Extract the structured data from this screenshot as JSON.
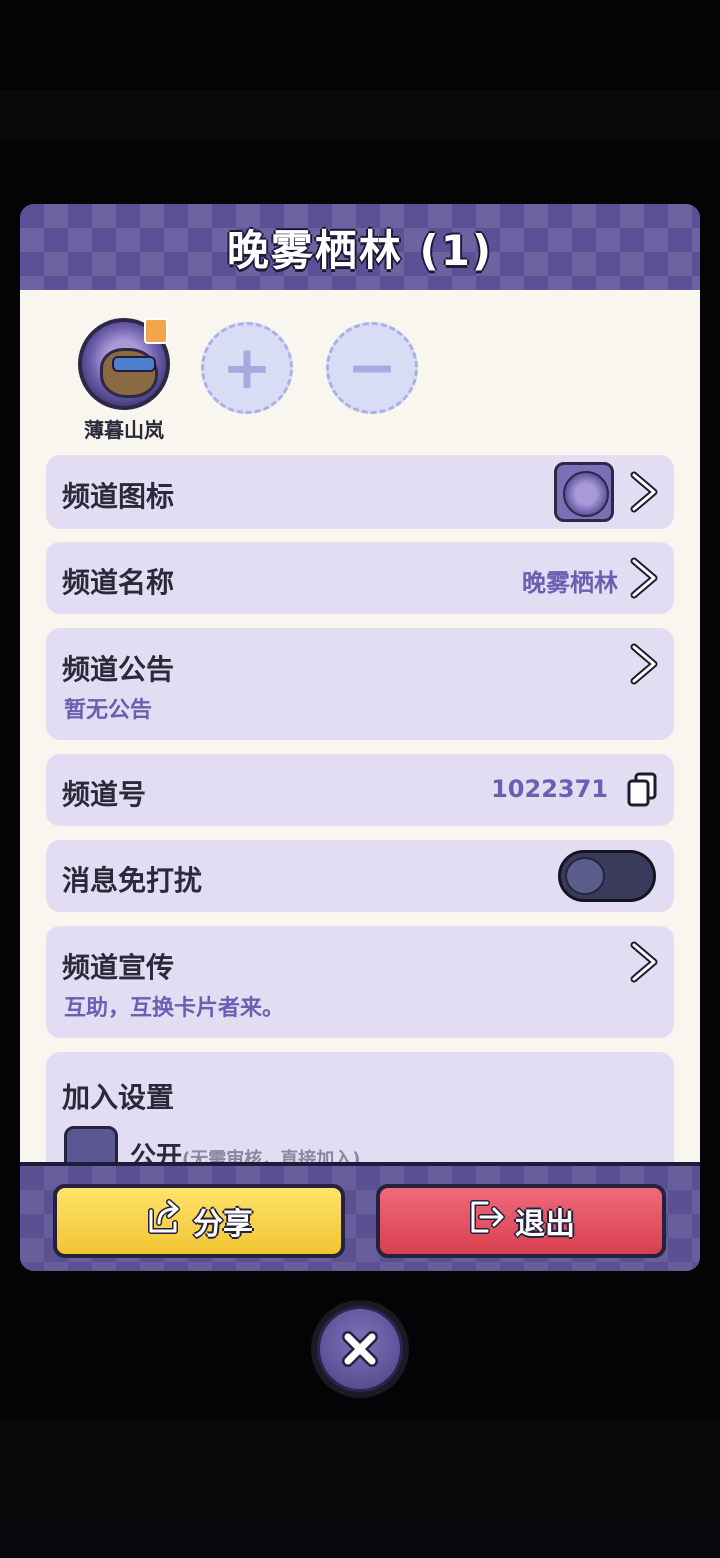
{
  "dialog": {
    "title": "晚雾栖林 (1)"
  },
  "members": {
    "owner_name": "薄暮山岚",
    "add_symbol": "+",
    "remove_symbol": "−"
  },
  "rows": {
    "icon": {
      "label": "频道图标"
    },
    "name": {
      "label": "频道名称",
      "value": "晚雾栖林"
    },
    "notice": {
      "label": "频道公告",
      "sub": "暂无公告"
    },
    "channel_id": {
      "label": "频道号",
      "value": "1022371"
    },
    "mute": {
      "label": "消息免打扰",
      "enabled": false
    },
    "promo": {
      "label": "频道宣传",
      "sub": "互助，互换卡片者来。"
    },
    "join": {
      "label": "加入设置",
      "option_label": "公开",
      "option_hint": "(无需审核，直接加入)"
    }
  },
  "footer": {
    "share_label": "分享",
    "exit_label": "退出"
  },
  "colors": {
    "accent_purple": "#5b5196",
    "share_yellow": "#f2c433",
    "exit_red": "#d8404f"
  }
}
